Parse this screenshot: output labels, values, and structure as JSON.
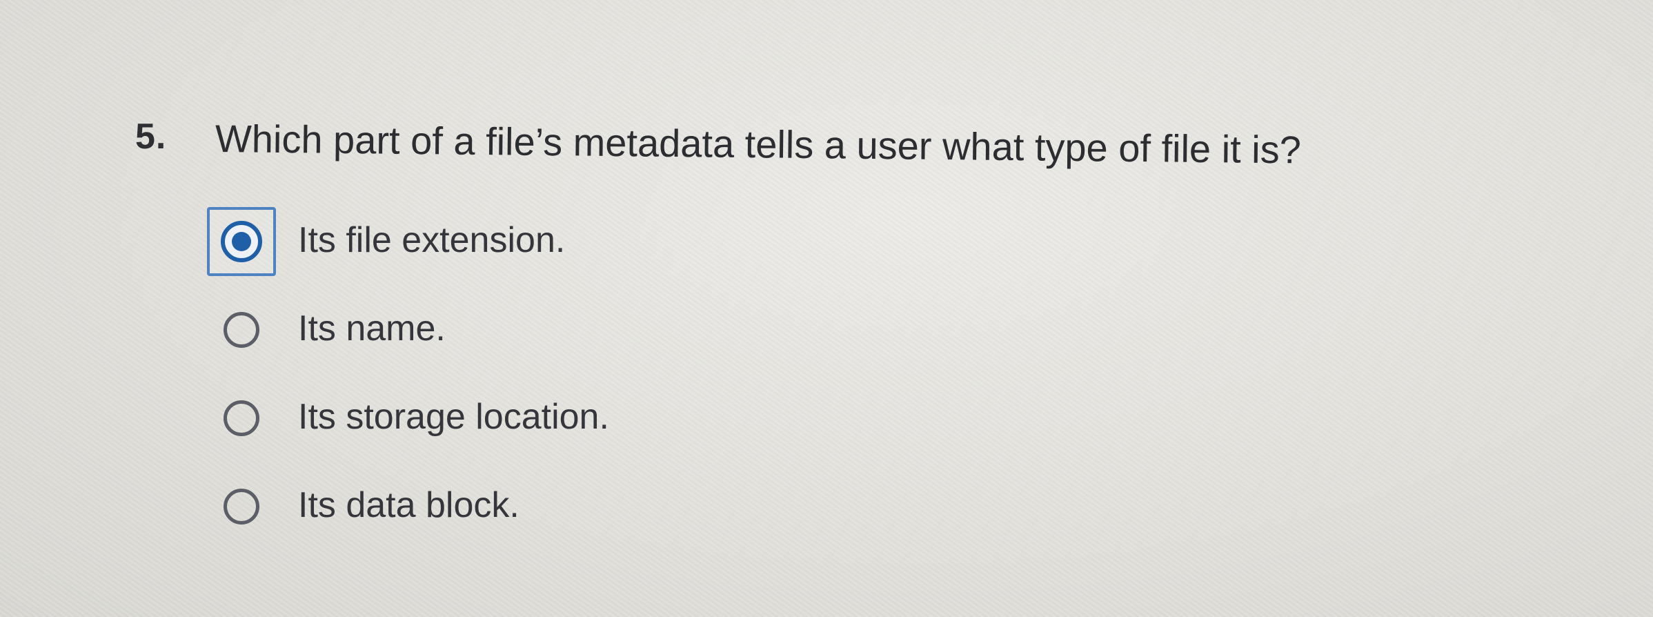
{
  "question": {
    "number": "5.",
    "text": "Which part of a file’s metadata tells a user what type of file it is?"
  },
  "options": [
    {
      "label": "Its file extension.",
      "selected": true
    },
    {
      "label": "Its name.",
      "selected": false
    },
    {
      "label": "Its storage location.",
      "selected": false
    },
    {
      "label": "Its data block.",
      "selected": false
    }
  ],
  "colors": {
    "accent": "#1f5fa8",
    "focus_ring": "#4e83c2",
    "text": "#2c2d31",
    "background": "#e4e3de"
  }
}
